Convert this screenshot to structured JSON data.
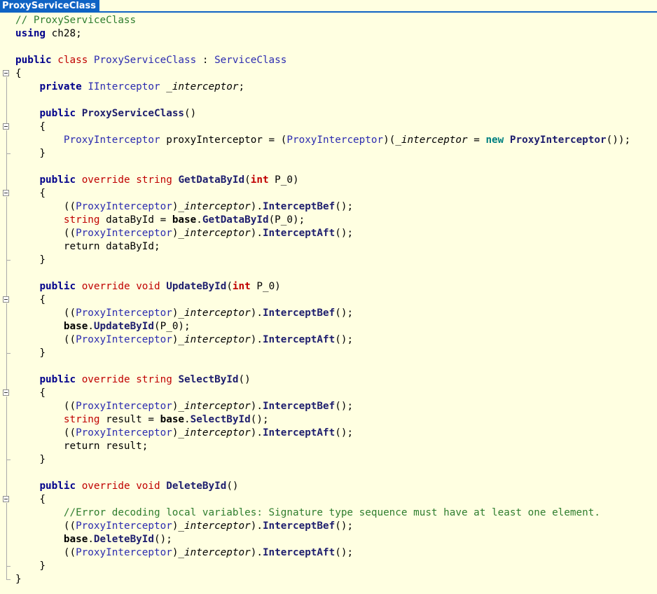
{
  "tab": {
    "title": "ProxyServiceClass"
  },
  "lines": [
    {
      "g": "none",
      "tokens": [
        [
          "cmt",
          "// ProxyServiceClass"
        ]
      ]
    },
    {
      "g": "none",
      "tokens": [
        [
          "kw",
          "using"
        ],
        [
          "pln",
          " ch28;"
        ]
      ]
    },
    {
      "g": "none",
      "tokens": []
    },
    {
      "g": "none",
      "tokens": [
        [
          "kw",
          "public"
        ],
        [
          "pln",
          " "
        ],
        [
          "kw2",
          "class"
        ],
        [
          "pln",
          " "
        ],
        [
          "typ",
          "ProxyServiceClass"
        ],
        [
          "pln",
          " : "
        ],
        [
          "typ",
          "ServiceClass"
        ]
      ]
    },
    {
      "g": "fold",
      "tokens": [
        [
          "pln",
          "{"
        ]
      ]
    },
    {
      "g": "bar",
      "tokens": [
        [
          "pln",
          "    "
        ],
        [
          "kw",
          "private"
        ],
        [
          "pln",
          " "
        ],
        [
          "typ",
          "IInterceptor"
        ],
        [
          "pln",
          " "
        ],
        [
          "fld",
          "_interceptor"
        ],
        [
          "pln",
          ";"
        ]
      ]
    },
    {
      "g": "bar",
      "tokens": []
    },
    {
      "g": "bar",
      "tokens": [
        [
          "pln",
          "    "
        ],
        [
          "kw",
          "public"
        ],
        [
          "pln",
          " "
        ],
        [
          "mtd",
          "ProxyServiceClass"
        ],
        [
          "pln",
          "()"
        ]
      ]
    },
    {
      "g": "fold",
      "tokens": [
        [
          "pln",
          "    {"
        ]
      ]
    },
    {
      "g": "bar",
      "tokens": [
        [
          "pln",
          "        "
        ],
        [
          "typ",
          "ProxyInterceptor"
        ],
        [
          "pln",
          " proxyInterceptor = ("
        ],
        [
          "typ",
          "ProxyInterceptor"
        ],
        [
          "pln",
          ")("
        ],
        [
          "fld",
          "_interceptor"
        ],
        [
          "pln",
          " = "
        ],
        [
          "new",
          "new"
        ],
        [
          "pln",
          " "
        ],
        [
          "mtd",
          "ProxyInterceptor"
        ],
        [
          "pln",
          "());"
        ]
      ]
    },
    {
      "g": "end",
      "tokens": [
        [
          "pln",
          "    }"
        ]
      ]
    },
    {
      "g": "bar",
      "tokens": []
    },
    {
      "g": "bar",
      "tokens": [
        [
          "pln",
          "    "
        ],
        [
          "kw",
          "public"
        ],
        [
          "pln",
          " "
        ],
        [
          "kw2",
          "override"
        ],
        [
          "pln",
          " "
        ],
        [
          "kw2",
          "string"
        ],
        [
          "pln",
          " "
        ],
        [
          "mtd",
          "GetDataById"
        ],
        [
          "pln",
          "("
        ],
        [
          "kw3",
          "int"
        ],
        [
          "pln",
          " P_0)"
        ]
      ]
    },
    {
      "g": "fold",
      "tokens": [
        [
          "pln",
          "    {"
        ]
      ]
    },
    {
      "g": "bar",
      "tokens": [
        [
          "pln",
          "        (("
        ],
        [
          "typ",
          "ProxyInterceptor"
        ],
        [
          "pln",
          ")"
        ],
        [
          "fld",
          "_interceptor"
        ],
        [
          "pln",
          ")."
        ],
        [
          "mtd",
          "InterceptBef"
        ],
        [
          "pln",
          "();"
        ]
      ]
    },
    {
      "g": "bar",
      "tokens": [
        [
          "pln",
          "        "
        ],
        [
          "kw2",
          "string"
        ],
        [
          "pln",
          " dataById = "
        ],
        [
          "bse",
          "base"
        ],
        [
          "pln",
          "."
        ],
        [
          "mtd",
          "GetDataById"
        ],
        [
          "pln",
          "(P_0);"
        ]
      ]
    },
    {
      "g": "bar",
      "tokens": [
        [
          "pln",
          "        (("
        ],
        [
          "typ",
          "ProxyInterceptor"
        ],
        [
          "pln",
          ")"
        ],
        [
          "fld",
          "_interceptor"
        ],
        [
          "pln",
          ")."
        ],
        [
          "mtd",
          "InterceptAft"
        ],
        [
          "pln",
          "();"
        ]
      ]
    },
    {
      "g": "bar",
      "tokens": [
        [
          "pln",
          "        return dataById;"
        ]
      ]
    },
    {
      "g": "end",
      "tokens": [
        [
          "pln",
          "    }"
        ]
      ]
    },
    {
      "g": "bar",
      "tokens": []
    },
    {
      "g": "bar",
      "tokens": [
        [
          "pln",
          "    "
        ],
        [
          "kw",
          "public"
        ],
        [
          "pln",
          " "
        ],
        [
          "kw2",
          "override"
        ],
        [
          "pln",
          " "
        ],
        [
          "kw2",
          "void"
        ],
        [
          "pln",
          " "
        ],
        [
          "mtd",
          "UpdateById"
        ],
        [
          "pln",
          "("
        ],
        [
          "kw3",
          "int"
        ],
        [
          "pln",
          " P_0)"
        ]
      ]
    },
    {
      "g": "fold",
      "tokens": [
        [
          "pln",
          "    {"
        ]
      ]
    },
    {
      "g": "bar",
      "tokens": [
        [
          "pln",
          "        (("
        ],
        [
          "typ",
          "ProxyInterceptor"
        ],
        [
          "pln",
          ")"
        ],
        [
          "fld",
          "_interceptor"
        ],
        [
          "pln",
          ")."
        ],
        [
          "mtd",
          "InterceptBef"
        ],
        [
          "pln",
          "();"
        ]
      ]
    },
    {
      "g": "bar",
      "tokens": [
        [
          "pln",
          "        "
        ],
        [
          "bse",
          "base"
        ],
        [
          "pln",
          "."
        ],
        [
          "mtd",
          "UpdateById"
        ],
        [
          "pln",
          "(P_0);"
        ]
      ]
    },
    {
      "g": "bar",
      "tokens": [
        [
          "pln",
          "        (("
        ],
        [
          "typ",
          "ProxyInterceptor"
        ],
        [
          "pln",
          ")"
        ],
        [
          "fld",
          "_interceptor"
        ],
        [
          "pln",
          ")."
        ],
        [
          "mtd",
          "InterceptAft"
        ],
        [
          "pln",
          "();"
        ]
      ]
    },
    {
      "g": "end",
      "tokens": [
        [
          "pln",
          "    }"
        ]
      ]
    },
    {
      "g": "bar",
      "tokens": []
    },
    {
      "g": "bar",
      "tokens": [
        [
          "pln",
          "    "
        ],
        [
          "kw",
          "public"
        ],
        [
          "pln",
          " "
        ],
        [
          "kw2",
          "override"
        ],
        [
          "pln",
          " "
        ],
        [
          "kw2",
          "string"
        ],
        [
          "pln",
          " "
        ],
        [
          "mtd",
          "SelectById"
        ],
        [
          "pln",
          "()"
        ]
      ]
    },
    {
      "g": "fold",
      "tokens": [
        [
          "pln",
          "    {"
        ]
      ]
    },
    {
      "g": "bar",
      "tokens": [
        [
          "pln",
          "        (("
        ],
        [
          "typ",
          "ProxyInterceptor"
        ],
        [
          "pln",
          ")"
        ],
        [
          "fld",
          "_interceptor"
        ],
        [
          "pln",
          ")."
        ],
        [
          "mtd",
          "InterceptBef"
        ],
        [
          "pln",
          "();"
        ]
      ]
    },
    {
      "g": "bar",
      "tokens": [
        [
          "pln",
          "        "
        ],
        [
          "kw2",
          "string"
        ],
        [
          "pln",
          " result = "
        ],
        [
          "bse",
          "base"
        ],
        [
          "pln",
          "."
        ],
        [
          "mtd",
          "SelectById"
        ],
        [
          "pln",
          "();"
        ]
      ]
    },
    {
      "g": "bar",
      "tokens": [
        [
          "pln",
          "        (("
        ],
        [
          "typ",
          "ProxyInterceptor"
        ],
        [
          "pln",
          ")"
        ],
        [
          "fld",
          "_interceptor"
        ],
        [
          "pln",
          ")."
        ],
        [
          "mtd",
          "InterceptAft"
        ],
        [
          "pln",
          "();"
        ]
      ]
    },
    {
      "g": "bar",
      "tokens": [
        [
          "pln",
          "        return result;"
        ]
      ]
    },
    {
      "g": "end",
      "tokens": [
        [
          "pln",
          "    }"
        ]
      ]
    },
    {
      "g": "bar",
      "tokens": []
    },
    {
      "g": "bar",
      "tokens": [
        [
          "pln",
          "    "
        ],
        [
          "kw",
          "public"
        ],
        [
          "pln",
          " "
        ],
        [
          "kw2",
          "override"
        ],
        [
          "pln",
          " "
        ],
        [
          "kw2",
          "void"
        ],
        [
          "pln",
          " "
        ],
        [
          "mtd",
          "DeleteById"
        ],
        [
          "pln",
          "()"
        ]
      ]
    },
    {
      "g": "fold",
      "tokens": [
        [
          "pln",
          "    {"
        ]
      ]
    },
    {
      "g": "bar",
      "tokens": [
        [
          "pln",
          "        "
        ],
        [
          "cmt",
          "//Error decoding local variables: Signature type sequence must have at least one element."
        ]
      ]
    },
    {
      "g": "bar",
      "tokens": [
        [
          "pln",
          "        (("
        ],
        [
          "typ",
          "ProxyInterceptor"
        ],
        [
          "pln",
          ")"
        ],
        [
          "fld",
          "_interceptor"
        ],
        [
          "pln",
          ")."
        ],
        [
          "mtd",
          "InterceptBef"
        ],
        [
          "pln",
          "();"
        ]
      ]
    },
    {
      "g": "bar",
      "tokens": [
        [
          "pln",
          "        "
        ],
        [
          "bse",
          "base"
        ],
        [
          "pln",
          "."
        ],
        [
          "mtd",
          "DeleteById"
        ],
        [
          "pln",
          "();"
        ]
      ]
    },
    {
      "g": "bar",
      "tokens": [
        [
          "pln",
          "        (("
        ],
        [
          "typ",
          "ProxyInterceptor"
        ],
        [
          "pln",
          ")"
        ],
        [
          "fld",
          "_interceptor"
        ],
        [
          "pln",
          ")."
        ],
        [
          "mtd",
          "InterceptAft"
        ],
        [
          "pln",
          "();"
        ]
      ]
    },
    {
      "g": "end",
      "tokens": [
        [
          "pln",
          "    }"
        ]
      ]
    },
    {
      "g": "last",
      "tokens": [
        [
          "pln",
          "}"
        ]
      ]
    }
  ]
}
